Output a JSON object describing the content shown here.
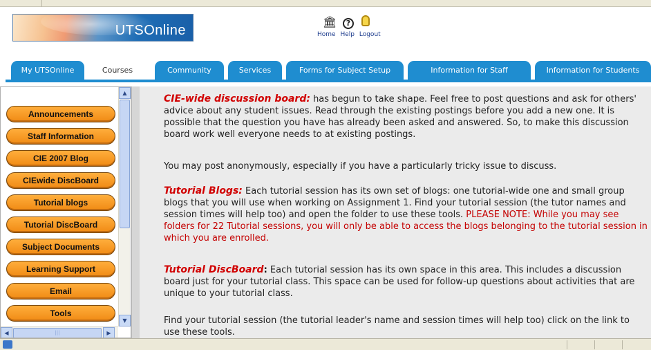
{
  "header": {
    "logo_text": "UTSOnline",
    "nav": [
      {
        "label": "Home",
        "icon": "home-icon"
      },
      {
        "label": "Help",
        "icon": "help-icon"
      },
      {
        "label": "Logout",
        "icon": "lock-icon"
      }
    ]
  },
  "tabs": [
    {
      "label": "My UTSOnline",
      "style": "blue"
    },
    {
      "label": "Courses",
      "style": "plain"
    },
    {
      "label": "Community",
      "style": "blue"
    },
    {
      "label": "Services",
      "style": "blue"
    },
    {
      "label": "Forms for Subject Setup",
      "style": "blue"
    },
    {
      "label": "Information for Staff",
      "style": "blue"
    },
    {
      "label": "Information for Students",
      "style": "blue"
    }
  ],
  "sidebar": {
    "items": [
      {
        "label": "Announcements"
      },
      {
        "label": "Staff Information"
      },
      {
        "label": "CIE 2007 Blog"
      },
      {
        "label": "CIEwide DiscBoard"
      },
      {
        "label": "Tutorial blogs"
      },
      {
        "label": "Tutorial DiscBoard"
      },
      {
        "label": "Subject Documents"
      },
      {
        "label": "Learning Support"
      },
      {
        "label": "Email"
      },
      {
        "label": "Tools"
      }
    ]
  },
  "content": {
    "p1_heading": "CIE-wide discussion board:",
    "p1_text": " has begun to take shape. Feel free to post questions and ask for others' advice about any student issues. Read through the existing postings before you add a new one. It is possible that the question you have has already been asked and answered. So, to make this discussion board work well everyone needs to at existing postings.",
    "p2_text": "You may post anonymously, especially if you have a particularly tricky issue to discuss.",
    "p3_heading": "Tutorial Blogs:",
    "p3_text": " Each tutorial session has its own set of blogs: one tutorial-wide one and small group blogs that you will use when working on Assignment 1. Find your tutorial session (the tutor names and session times will help too) and open the folder to use these tools. ",
    "p3_note": "PLEASE NOTE: While you may see folders for 22 Tutorial sessions, you will only be able to access the blogs belonging to the tutorial session in which you are enrolled.",
    "p4_heading": "Tutorial DiscBoard",
    "p4_colon": ":",
    "p4_text": " Each tutorial session has its own space in this area. This includes a discussion board just for your tutorial class. This space can be used for follow-up questions about activities that are unique to your tutorial class.",
    "p5_text": "Find your tutorial session (the tutorial leader's name and session times will help too) click on the link to use these tools."
  },
  "colors": {
    "tab_blue": "#1f8dd0",
    "menu_orange": "#f5961e",
    "highlight_red": "#d10000",
    "content_bg": "#ebebeb"
  }
}
